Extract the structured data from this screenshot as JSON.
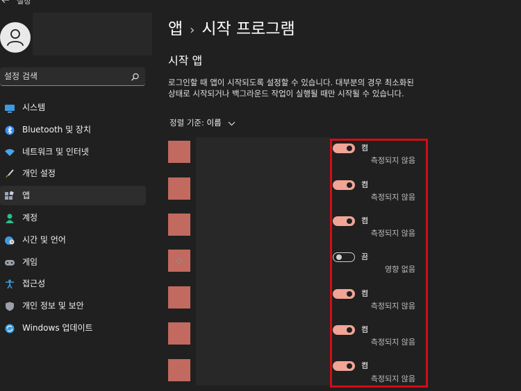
{
  "window": {
    "title": "설정",
    "back_icon": "back-arrow-icon"
  },
  "search": {
    "placeholder": "설정 검색",
    "icon": "search-icon"
  },
  "sidebar": {
    "items": [
      {
        "label": "시스템",
        "icon": "monitor-icon",
        "color": "#3b9be0"
      },
      {
        "label": "Bluetooth 및 장치",
        "icon": "bluetooth-icon",
        "color": "#3b8ee8"
      },
      {
        "label": "네트워크 및 인터넷",
        "icon": "wifi-icon",
        "color": "#4aa6e8"
      },
      {
        "label": "개인 설정",
        "icon": "brush-icon",
        "color": "#e8a84a"
      },
      {
        "label": "앱",
        "icon": "apps-icon",
        "color": "#9aa6b8",
        "selected": true
      },
      {
        "label": "계정",
        "icon": "account-icon",
        "color": "#2bbf8a"
      },
      {
        "label": "시간 및 언어",
        "icon": "globe-clock-icon",
        "color": "#3b9be0"
      },
      {
        "label": "게임",
        "icon": "gamepad-icon",
        "color": "#9aa0a8"
      },
      {
        "label": "접근성",
        "icon": "accessibility-icon",
        "color": "#3b9be0"
      },
      {
        "label": "개인 정보 및 보안",
        "icon": "shield-icon",
        "color": "#9aa0a8"
      },
      {
        "label": "Windows 업데이트",
        "icon": "update-icon",
        "color": "#3b9be0"
      }
    ]
  },
  "main": {
    "breadcrumb": {
      "parent": "앱",
      "separator": "›",
      "current": "시작 프로그램"
    },
    "section_title": "시작 앱",
    "description": "로그인할 때 앱이 시작되도록 설정할 수 있습니다. 대부분의 경우 최소화된 상태로 시작되거나 백그라운드 작업이 실행될 때만 시작될 수 있습니다.",
    "sort": {
      "label": "정렬 기준:",
      "value": "이름"
    },
    "accent_color": "#f0a596",
    "highlight_color": "#d40d15",
    "apps": [
      {
        "on": true,
        "state": "켬",
        "impact": "측정되지 않음"
      },
      {
        "on": true,
        "state": "켬",
        "impact": "측정되지 않음"
      },
      {
        "on": true,
        "state": "켬",
        "impact": "측정되지 않음"
      },
      {
        "on": false,
        "state": "끔",
        "impact": "영향 없음"
      },
      {
        "on": true,
        "state": "켬",
        "impact": "측정되지 않음"
      },
      {
        "on": true,
        "state": "켬",
        "impact": "측정되지 않음"
      },
      {
        "on": true,
        "state": "켬",
        "impact": "측정되지 않음"
      }
    ]
  }
}
